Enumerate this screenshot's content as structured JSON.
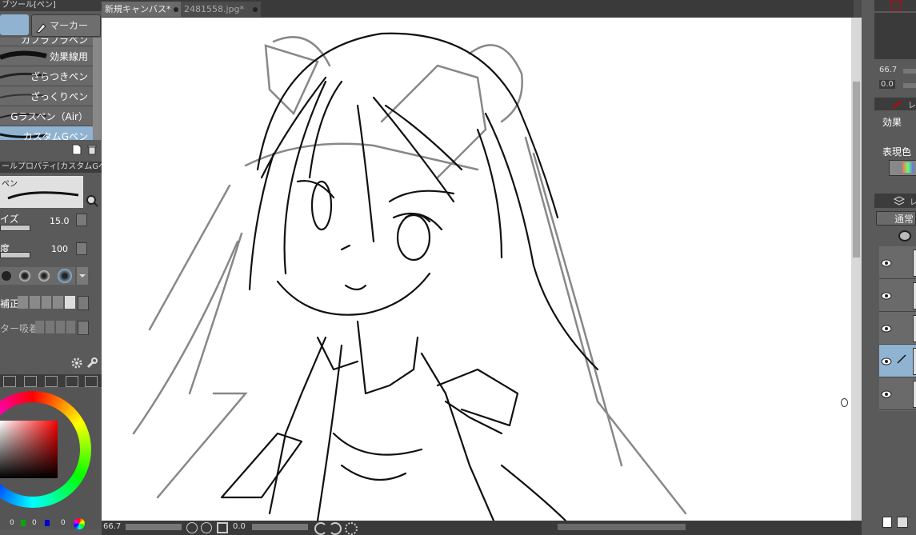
{
  "tabs": [
    {
      "label": "新規キャンバス*",
      "active": true
    },
    {
      "label": "2481558.jpg*",
      "active": false
    }
  ],
  "sub_tool": {
    "header": "ブツール[ペン]",
    "buttons": [
      "",
      "マーカー"
    ],
    "brushes": [
      "カブラブラペン",
      "効果線用",
      "ざらつきペン",
      "ざっくりペン",
      "Gラスペン（Air）",
      "カスタムGペン"
    ]
  },
  "tool_property": {
    "header": "ールプロパティ[カスタムGペン]",
    "preview_label": "ペン",
    "size_label": "イズ",
    "size_value": "15.0",
    "opacity_label": "度",
    "opacity_value": "100",
    "correction_label": "補正",
    "vector_snap_label": "ター吸着"
  },
  "color": {
    "ring_colors": [
      "#ff0000",
      "#ffff00",
      "#00ff00",
      "#00ffff",
      "#0000ff",
      "#ff00ff"
    ],
    "square_base": "#ff0000",
    "rgb_labels": [
      "0",
      "0",
      "0"
    ]
  },
  "status_bar": {
    "zoom": "66.7",
    "rotation": "0.0"
  },
  "right_panel": {
    "zoom_value": "66.7",
    "angle_value": "0.0",
    "effect_label": "効果",
    "display_color_label": "表現色",
    "blend_mode": "通常",
    "layer_tab_initial": "レ"
  }
}
